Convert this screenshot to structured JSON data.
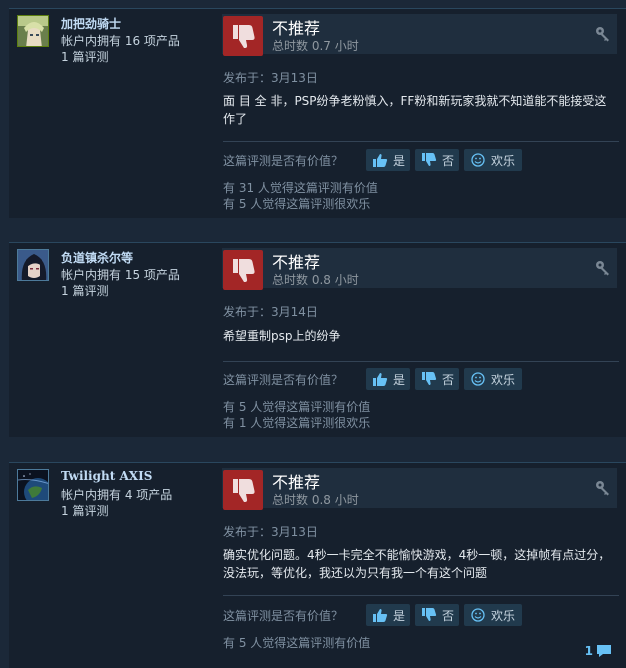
{
  "helpful_question": "这篇评测是否有价值？",
  "buttons": {
    "yes": "是",
    "no": "否",
    "funny": "欢乐"
  },
  "colors": {
    "background": "#1b2838",
    "card": "#16202d",
    "not_recommended": "#a32626",
    "link": "#67c1f5"
  },
  "reviews": [
    {
      "persona": "加把劲骑士",
      "owned": "帐户内拥有 16 项产品",
      "review_count": "1 篇评测",
      "avatar_icon": "anime-knight-avatar",
      "verdict": "不推荐",
      "hours": "总时数 0.7 小时",
      "posted": "发布于：3月13日",
      "text": "面 目 全 非，PSP纷争老粉慎入，FF粉和新玩家我就不知道能不能接受这作了",
      "helpful_stat": "有 31 人觉得这篇评测有价值",
      "funny_stat": "有 5 人觉得这篇评测很欢乐"
    },
    {
      "persona": "负道镇杀尔等",
      "owned": "帐户内拥有 15 项产品",
      "review_count": "1 篇评测",
      "avatar_icon": "dark-hair-character-avatar",
      "verdict": "不推荐",
      "hours": "总时数 0.8 小时",
      "posted": "发布于：3月14日",
      "text": "希望重制psp上的纷争",
      "helpful_stat": "有 5 人觉得这篇评测有价值",
      "funny_stat": "有 1 人觉得这篇评测很欢乐"
    },
    {
      "persona": "Twilight AXIS",
      "owned": "帐户内拥有 4 项产品",
      "review_count": "1 篇评测",
      "avatar_icon": "earth-space-avatar",
      "verdict": "不推荐",
      "hours": "总时数 0.8 小时",
      "posted": "发布于：3月13日",
      "text": "确实优化问题。4秒一卡完全不能愉快游戏，4秒一顿，这掉帧有点过分，没法玩，等优化，我还以为只有我一个有这个问题",
      "helpful_stat": "有 5 人觉得这篇评测有价值",
      "comment_count": "1"
    }
  ]
}
